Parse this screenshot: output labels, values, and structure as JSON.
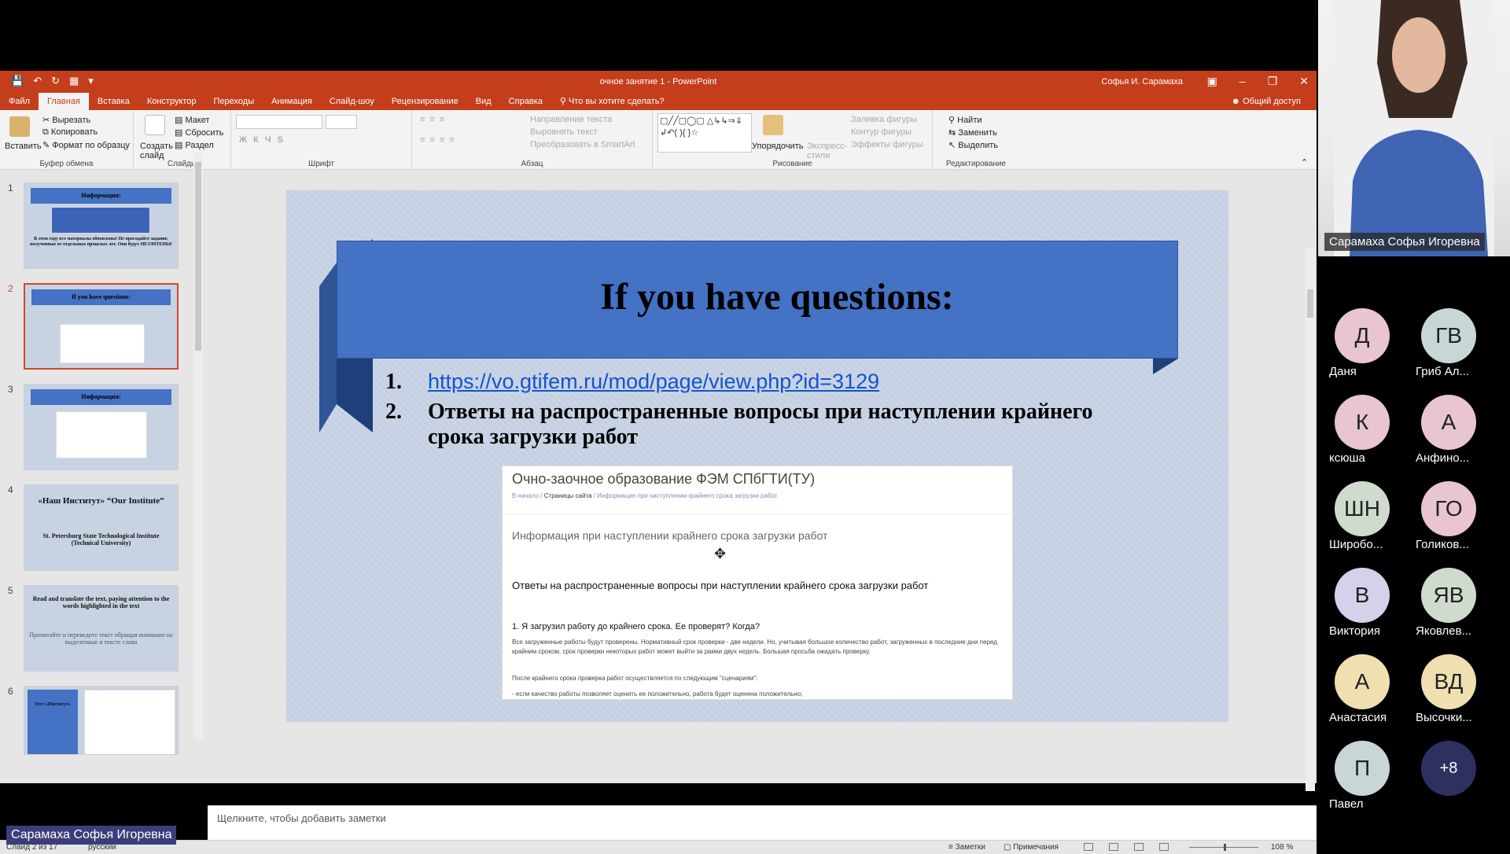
{
  "titlebar": {
    "title": "очное занятие 1 - PowerPoint",
    "user": "Софья И. Сарамаха"
  },
  "tabs": [
    "Файл",
    "Главная",
    "Вставка",
    "Конструктор",
    "Переходы",
    "Анимация",
    "Слайд-шоу",
    "Рецензирование",
    "Вид",
    "Справка"
  ],
  "tellme": "Что вы хотите сделать?",
  "share": "Общий доступ",
  "ribbon": {
    "paste": "Вставить",
    "cut": "Вырезать",
    "copy": "Копировать",
    "format_painter": "Формат по образцу",
    "clipboard_group": "Буфер обмена",
    "new_slide": "Создать слайд",
    "layout": "Макет",
    "reset": "Сбросить",
    "section": "Раздел",
    "slides_group": "Слайды",
    "font_group": "Шрифт",
    "text_direction": "Направление текста",
    "align_text": "Выровнять текст",
    "smartart": "Преобразовать в SmartArt",
    "paragraph_group": "Абзац",
    "arrange": "Упорядочить",
    "quick_styles": "Экспресс-стили",
    "shape_fill": "Заливка фигуры",
    "shape_outline": "Контур фигуры",
    "shape_effects": "Эффекты фигуры",
    "drawing_group": "Рисование",
    "find": "Найти",
    "replace": "Заменить",
    "select": "Выделить",
    "editing_group": "Редактирование"
  },
  "thumbnails": [
    {
      "num": "1",
      "title": "Информация:",
      "text": "В этом году все материалы обновлены! Не прогадайте задание, полученные от отдельных прошлых лет. Они будут НЕЗАЧТЕНЫ!"
    },
    {
      "num": "2",
      "title": "If you have questions:",
      "text": ""
    },
    {
      "num": "3",
      "title": "Информация:",
      "text": ""
    },
    {
      "num": "4",
      "title": "«Наш Институт» “Our Institute”",
      "text": "St. Petersburg State Technological Institute (Technical University)"
    },
    {
      "num": "5",
      "title": "Read and translate the text, paying attention to the words highlighted in the text",
      "text": "Прочитайте и переведите текст обращая внимание на выделенные в тексте слова"
    },
    {
      "num": "6",
      "title": "Тест «Институт»",
      "text": ""
    }
  ],
  "slide": {
    "title": "If you have questions:",
    "item1_num": "1.",
    "item1_link": "https://vo.gtifem.ru/mod/page/view.php?id=3129",
    "item2_num": "2.",
    "item2_line1": "Ответы на распространенные вопросы при наступлении крайнего",
    "item2_line2": "срока загрузки работ",
    "shot": {
      "header": "Очно-заочное образование ФЭМ СПбГТИ(ТУ)",
      "bc1": "В начало",
      "bc2": "Страницы сайта",
      "bc3": "Информация при наступлении крайнего срока загрузки работ",
      "subtitle": "Информация при наступлении крайнего срока загрузки работ",
      "question": "Ответы на распространенные вопросы при наступлении крайнего срока загрузки работ",
      "q1": "1. Я загрузил работу до крайнего срока. Ее проверят? Когда?",
      "p1": "Все загруженные работы будут проверены. Нормативный срок проверки - две недели. Но, учитывая большое количество работ, загруженных в последние дни перед крайним сроком, срок проверки некоторых работ может выйти за рамки двух недель. Большая просьба ожидать проверку.",
      "p2": "После крайнего срока проверка работ осуществляется по следующим \"сценариям\":",
      "p3": "- если качество работы позволяет оценить ее положительно, работа будет оценена положительно;"
    }
  },
  "notes_placeholder": "Щелкните, чтобы добавить заметки",
  "status": {
    "slide_of": "Слайд 2 из 17",
    "language": "русский",
    "notes": "Заметки",
    "comments": "Примечания",
    "zoom": "108 %"
  },
  "video_name": "Сарамаха Софья Игоревна",
  "self_name": "Сарамаха Софья Игоревна",
  "participants": [
    {
      "initials": "Д",
      "name": "Даня",
      "color": "#e8c5cf"
    },
    {
      "initials": "ГВ",
      "name": "Гриб Ал...",
      "color": "#c9d6d8"
    },
    {
      "initials": "К",
      "name": "ксюша",
      "color": "#e8c5cf"
    },
    {
      "initials": "А",
      "name": "Анфино...",
      "color": "#e8c5cf"
    },
    {
      "initials": "ШН",
      "name": "Широбо...",
      "color": "#cfdccd"
    },
    {
      "initials": "ГО",
      "name": "Голиков...",
      "color": "#e8c5cf"
    },
    {
      "initials": "В",
      "name": "Виктория",
      "color": "#d4d2ea"
    },
    {
      "initials": "ЯВ",
      "name": "Яковлев...",
      "color": "#cfdccd"
    },
    {
      "initials": "А",
      "name": "Анастасия",
      "color": "#f0e0b0"
    },
    {
      "initials": "ВД",
      "name": "Высочки...",
      "color": "#f0e0b0"
    },
    {
      "initials": "П",
      "name": "Павел",
      "color": "#c9d6d8"
    },
    {
      "initials": "+8",
      "name": "",
      "color": "#2e3160"
    }
  ]
}
